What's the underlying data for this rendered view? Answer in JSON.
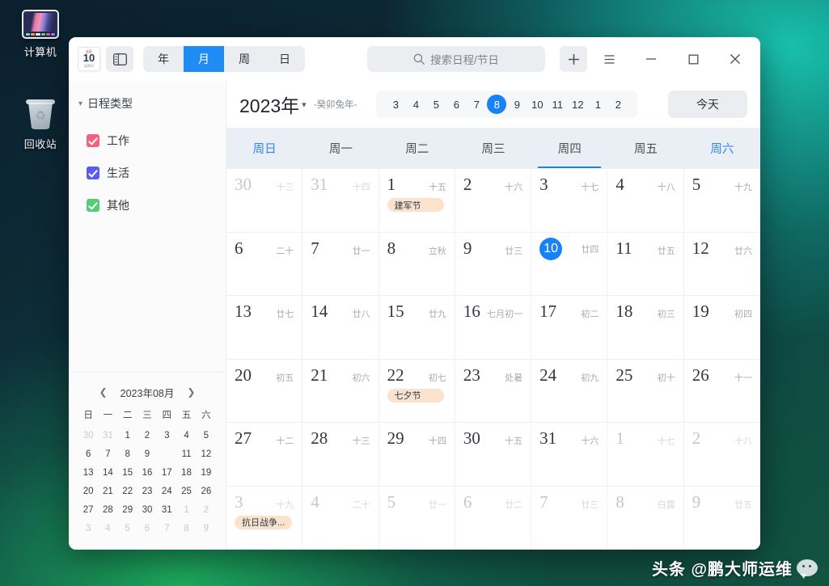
{
  "desktop": {
    "icons": [
      {
        "name": "computer",
        "label": "计算机"
      },
      {
        "name": "recycle-bin",
        "label": "回收站"
      }
    ],
    "watermark": {
      "text": "头条 @鹏大师运维",
      "icon": "wechat-bubble-icon"
    }
  },
  "window": {
    "app_icon": {
      "month_text": "8月",
      "day_text": "10",
      "weekday_text": "星期四"
    },
    "sidebar_toggle_icon": "sidebar-toggle-icon",
    "views": [
      {
        "key": "year",
        "label": "年",
        "active": false
      },
      {
        "key": "month",
        "label": "月",
        "active": true
      },
      {
        "key": "week",
        "label": "周",
        "active": false
      },
      {
        "key": "day",
        "label": "日",
        "active": false
      }
    ],
    "search": {
      "placeholder": "搜索日程/节日",
      "icon": "search-icon",
      "value": ""
    },
    "titlebar_buttons": [
      {
        "name": "add-schedule-button",
        "icon": "plus-icon",
        "label": "+"
      },
      {
        "name": "menu-button",
        "icon": "hamburger-menu-icon",
        "label": "≡"
      },
      {
        "name": "minimize-button",
        "icon": "minimize-icon",
        "label": "—"
      },
      {
        "name": "maximize-button",
        "icon": "maximize-icon",
        "label": "□"
      },
      {
        "name": "close-button",
        "icon": "close-icon",
        "label": "✕"
      }
    ]
  },
  "sidebar": {
    "section_title": "日程类型",
    "categories": [
      {
        "label": "工作",
        "color": "#f4637e",
        "checked": true
      },
      {
        "label": "生活",
        "color": "#5b5bf0",
        "checked": true
      },
      {
        "label": "其他",
        "color": "#55cc77",
        "checked": true
      }
    ],
    "mini_calendar": {
      "title": "2023年08月",
      "prev_icon": "chevron-left-icon",
      "next_icon": "chevron-right-icon",
      "weekdays": [
        "日",
        "一",
        "二",
        "三",
        "四",
        "五",
        "六"
      ],
      "days": [
        {
          "d": "30",
          "dim": true
        },
        {
          "d": "31",
          "dim": true
        },
        {
          "d": "1"
        },
        {
          "d": "2"
        },
        {
          "d": "3"
        },
        {
          "d": "4"
        },
        {
          "d": "5"
        },
        {
          "d": "6"
        },
        {
          "d": "7"
        },
        {
          "d": "8"
        },
        {
          "d": "9"
        },
        {
          "d": "10",
          "today": true
        },
        {
          "d": "11"
        },
        {
          "d": "12"
        },
        {
          "d": "13"
        },
        {
          "d": "14"
        },
        {
          "d": "15"
        },
        {
          "d": "16"
        },
        {
          "d": "17"
        },
        {
          "d": "18"
        },
        {
          "d": "19"
        },
        {
          "d": "20"
        },
        {
          "d": "21"
        },
        {
          "d": "22"
        },
        {
          "d": "23"
        },
        {
          "d": "24"
        },
        {
          "d": "25"
        },
        {
          "d": "26"
        },
        {
          "d": "27"
        },
        {
          "d": "28"
        },
        {
          "d": "29"
        },
        {
          "d": "30"
        },
        {
          "d": "31"
        },
        {
          "d": "1",
          "dim": true
        },
        {
          "d": "2",
          "dim": true
        },
        {
          "d": "3",
          "dim": true
        },
        {
          "d": "4",
          "dim": true
        },
        {
          "d": "5",
          "dim": true
        },
        {
          "d": "6",
          "dim": true
        },
        {
          "d": "7",
          "dim": true
        },
        {
          "d": "8",
          "dim": true
        },
        {
          "d": "9",
          "dim": true
        }
      ]
    }
  },
  "main": {
    "year_label": "2023年",
    "year_chevron_icon": "chevron-down-icon",
    "zodiac": "-癸卯兔年-",
    "months": [
      "3",
      "4",
      "5",
      "6",
      "7",
      "8",
      "9",
      "10",
      "11",
      "12",
      "1",
      "2"
    ],
    "selected_month": "8",
    "today_button": "今天",
    "weekdays": [
      {
        "label": "周日",
        "weekend": true,
        "current": false
      },
      {
        "label": "周一",
        "weekend": false,
        "current": false
      },
      {
        "label": "周二",
        "weekend": false,
        "current": false
      },
      {
        "label": "周三",
        "weekend": false,
        "current": false
      },
      {
        "label": "周四",
        "weekend": false,
        "current": true
      },
      {
        "label": "周五",
        "weekend": false,
        "current": false
      },
      {
        "label": "周六",
        "weekend": true,
        "current": false
      }
    ],
    "days": [
      {
        "day": "30",
        "lunar": "十三",
        "out": true
      },
      {
        "day": "31",
        "lunar": "十四",
        "out": true
      },
      {
        "day": "1",
        "lunar": "十五",
        "event": "建军节"
      },
      {
        "day": "2",
        "lunar": "十六"
      },
      {
        "day": "3",
        "lunar": "十七"
      },
      {
        "day": "4",
        "lunar": "十八"
      },
      {
        "day": "5",
        "lunar": "十九"
      },
      {
        "day": "6",
        "lunar": "二十"
      },
      {
        "day": "7",
        "lunar": "廿一"
      },
      {
        "day": "8",
        "lunar": "立秋"
      },
      {
        "day": "9",
        "lunar": "廿三"
      },
      {
        "day": "10",
        "lunar": "廿四",
        "today": true
      },
      {
        "day": "11",
        "lunar": "廿五"
      },
      {
        "day": "12",
        "lunar": "廿六"
      },
      {
        "day": "13",
        "lunar": "廿七"
      },
      {
        "day": "14",
        "lunar": "廿八"
      },
      {
        "day": "15",
        "lunar": "廿九"
      },
      {
        "day": "16",
        "lunar": "七月初一"
      },
      {
        "day": "17",
        "lunar": "初二"
      },
      {
        "day": "18",
        "lunar": "初三"
      },
      {
        "day": "19",
        "lunar": "初四"
      },
      {
        "day": "20",
        "lunar": "初五"
      },
      {
        "day": "21",
        "lunar": "初六"
      },
      {
        "day": "22",
        "lunar": "初七",
        "event": "七夕节"
      },
      {
        "day": "23",
        "lunar": "处暑"
      },
      {
        "day": "24",
        "lunar": "初九"
      },
      {
        "day": "25",
        "lunar": "初十"
      },
      {
        "day": "26",
        "lunar": "十一"
      },
      {
        "day": "27",
        "lunar": "十二"
      },
      {
        "day": "28",
        "lunar": "十三"
      },
      {
        "day": "29",
        "lunar": "十四"
      },
      {
        "day": "30",
        "lunar": "十五"
      },
      {
        "day": "31",
        "lunar": "十六"
      },
      {
        "day": "1",
        "lunar": "十七",
        "out": true
      },
      {
        "day": "2",
        "lunar": "十八",
        "out": true
      },
      {
        "day": "3",
        "lunar": "十九",
        "out": true,
        "event": "抗日战争..."
      },
      {
        "day": "4",
        "lunar": "二十",
        "out": true
      },
      {
        "day": "5",
        "lunar": "廿一",
        "out": true
      },
      {
        "day": "6",
        "lunar": "廿二",
        "out": true
      },
      {
        "day": "7",
        "lunar": "廿三",
        "out": true
      },
      {
        "day": "8",
        "lunar": "白露",
        "out": true
      },
      {
        "day": "9",
        "lunar": "廿五",
        "out": true
      }
    ]
  }
}
